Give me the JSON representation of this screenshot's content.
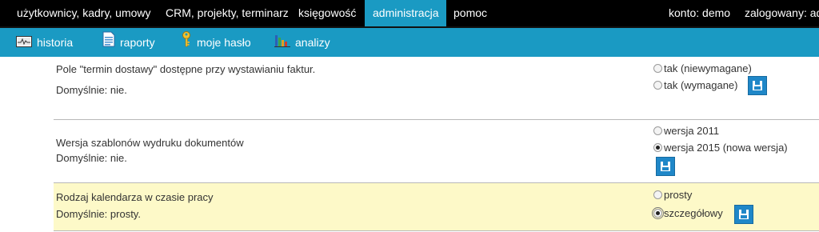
{
  "topnav": {
    "items": [
      "użytkownicy, kadry, umowy",
      "CRM, projekty, terminarz",
      "księgowość",
      "administracja",
      "pomoc"
    ],
    "active_index": 3,
    "account_label": "konto: demo",
    "logged_label": "zalogowany: ad"
  },
  "subnav": {
    "items": [
      "historia",
      "raporty",
      "moje hasło",
      "analizy"
    ]
  },
  "settings": [
    {
      "title": "Pole \"termin dostawy\" dostępne przy wystawianiu faktur.",
      "default": "Domyślnie: nie.",
      "options": [
        "tak (niewymagane)",
        "tak (wymagane)"
      ],
      "selected": -1
    },
    {
      "title": "Wersja szablonów wydruku dokumentów",
      "default": "Domyślnie: nie.",
      "options": [
        "wersja 2011",
        "wersja 2015 (nowa wersja)"
      ],
      "selected": 1
    },
    {
      "title": "Rodzaj kalendarza w czasie pracy",
      "default": "Domyślnie: prosty.",
      "options": [
        "prosty",
        "szczegółowy"
      ],
      "selected": 1
    }
  ],
  "colors": {
    "topbar": "#000000",
    "accent": "#1a9ac3",
    "highlight_row": "#fdf9c8",
    "save_button": "#1f87c8"
  },
  "icons": {
    "historia": "monitor-chart-icon",
    "raporty": "document-icon",
    "moje_haslo": "key-icon",
    "analizy": "bar-chart-icon",
    "save": "floppy-disk-icon"
  }
}
